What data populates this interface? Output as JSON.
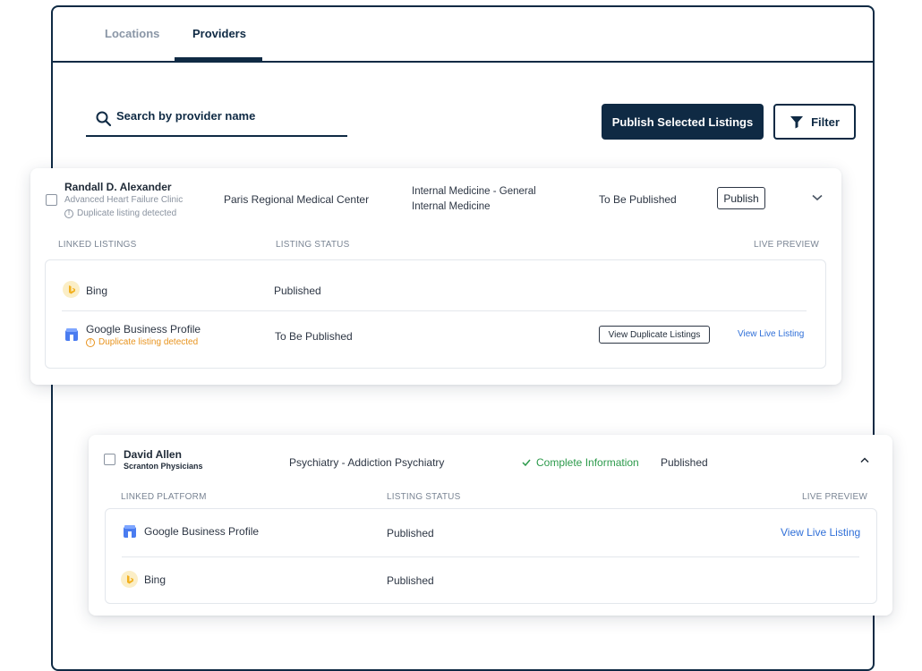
{
  "tabs": [
    "Locations",
    "Providers"
  ],
  "search": {
    "placeholder": "Search by provider name"
  },
  "toolbar": {
    "publish_selected_label": "Publish Selected Listings",
    "filter_label": "Filter"
  },
  "providers": [
    {
      "name": "Randall D. Alexander",
      "practice": "Advanced Heart Failure Clinic",
      "warning": "Duplicate listing detected",
      "location": "Paris Regional Medical Center",
      "specialty_line1": "Internal Medicine - General",
      "specialty_line2": "Internal Medicine",
      "status": "To Be Published",
      "publish_label": "Publish",
      "columns": [
        "LINKED LISTINGS",
        "LISTING STATUS",
        "LIVE PREVIEW"
      ],
      "listings": [
        {
          "platform": "Bing",
          "status": "Published"
        },
        {
          "platform": "Google Business Profile",
          "warning": "Duplicate listing detected",
          "status": "To Be Published",
          "action": "View Duplicate Listings",
          "preview": "View Live Listing"
        }
      ]
    },
    {
      "name": "David Allen",
      "practice": "Scranton Physicians",
      "specialty": "Psychiatry - Addiction Psychiatry",
      "info": "Complete Information",
      "status": "Published",
      "columns": [
        "LINKED PLATFORM",
        "LISTING STATUS",
        "LIVE PREVIEW"
      ],
      "listings": [
        {
          "platform": "Google Business Profile",
          "status": "Published",
          "preview": "View Live Listing"
        },
        {
          "platform": "Bing",
          "status": "Published"
        }
      ]
    }
  ],
  "colors": {
    "navy": "#0f2a44",
    "link": "#2f6fd8",
    "warning": "#e8941f",
    "success": "#2c9a4b"
  }
}
